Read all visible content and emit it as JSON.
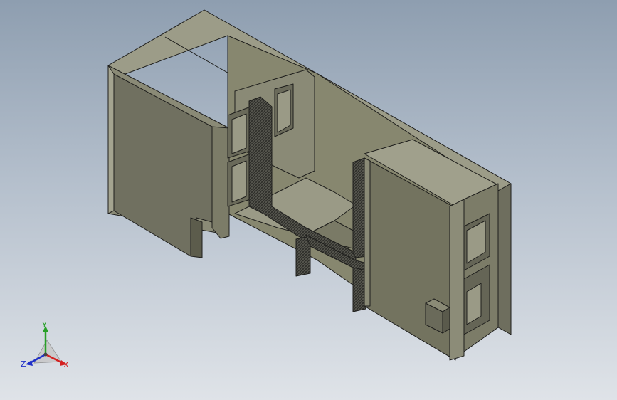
{
  "viewport": {
    "background_top": "#8e9eb0",
    "background_bottom": "#dfe3e8",
    "model_face_light": "#9a9a86",
    "model_face_mid": "#85856f",
    "model_face_dark": "#707060",
    "section_hatch": "#4a4a44",
    "edge_color": "#1e1e1c"
  },
  "triad": {
    "y_label": "Y",
    "x_label": "X",
    "z_label": "Z",
    "x_color": "#d42020",
    "y_color": "#28a028",
    "z_color": "#2030c8"
  }
}
